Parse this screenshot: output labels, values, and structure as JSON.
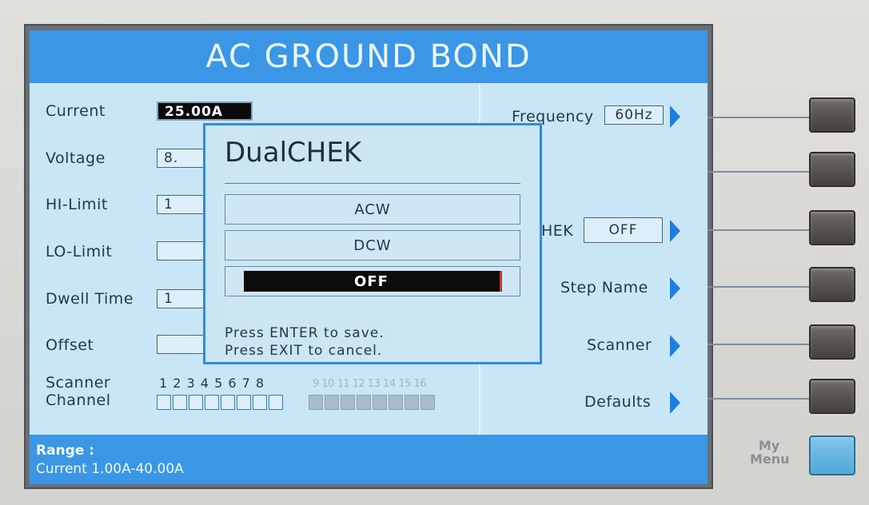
{
  "screen": {
    "title": "AC GROUND BOND",
    "params": {
      "current_label": "Current",
      "current_value": "25.00A",
      "voltage_label": "Voltage",
      "voltage_value": "8.",
      "hi_limit_label": "HI-Limit",
      "hi_limit_value": "1",
      "lo_limit_label": "LO-Limit",
      "lo_limit_value": "",
      "dwell_label": "Dwell Time",
      "dwell_value": "1",
      "offset_label": "Offset",
      "offset_value": ""
    },
    "scanner": {
      "label_line1": "Scanner",
      "label_line2": "Channel",
      "channels_enabled": "1 2 3 4 5 6 7 8",
      "channels_disabled": "9 10 11 12 13 14 15 16"
    },
    "softkeys": {
      "frequency_label": "Frequency",
      "frequency_value": "60Hz",
      "dualchek_label_partial": "HEK",
      "dualchek_value": "OFF",
      "step_name_label": "Step Name",
      "scanner_label": "Scanner",
      "defaults_label": "Defaults"
    },
    "status": {
      "line1": "Range :",
      "line2": "Current 1.00A-40.00A"
    }
  },
  "dialog": {
    "title": "DualCHEK",
    "options": [
      "ACW",
      "DCW",
      "OFF"
    ],
    "selected": "OFF",
    "msg_line1": "Press ENTER to save.",
    "msg_line2": "Press EXIT to cancel."
  },
  "panel": {
    "my_menu_line1": "My",
    "my_menu_line2": "Menu"
  },
  "colors": {
    "title_bar": "#3b97e6",
    "screen_bg": "#c9e6f6",
    "arrow": "#1c7fe0",
    "selected_bg": "#0c0c0c"
  }
}
